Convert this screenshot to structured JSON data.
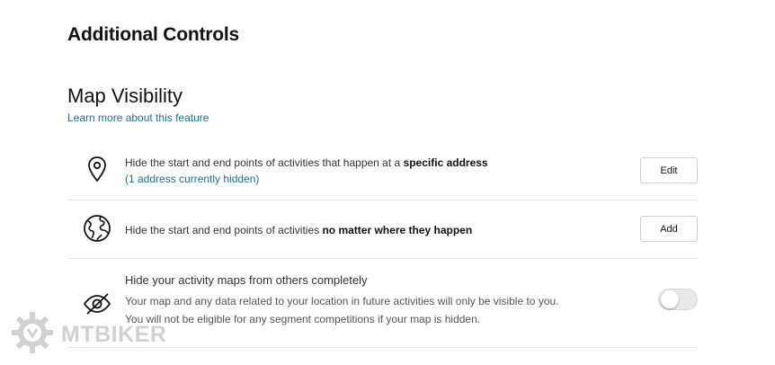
{
  "header": {
    "title": "Additional Controls"
  },
  "map_visibility": {
    "title": "Map Visibility",
    "learn_more": "Learn more about this feature",
    "rows": [
      {
        "icon": "location-pin-icon",
        "text_before": "Hide the start and end points of activities that happen at a ",
        "text_bold": "specific address",
        "hint": "(1 address currently hidden)",
        "button": "Edit"
      },
      {
        "icon": "globe-icon",
        "text_before": "Hide the start and end points of activities ",
        "text_bold": "no matter where they happen",
        "button": "Add"
      },
      {
        "icon": "eye-slash-icon",
        "title": "Hide your activity maps from others completely",
        "desc_line1": "Your map and any data related to your location in future activities will only be visible to you.",
        "desc_line2": "You will not be eligible for any segment competitions if your map is hidden.",
        "toggle_on": false
      }
    ]
  },
  "watermark": {
    "icon": "gear-logo-icon",
    "text": "MTBIKER"
  },
  "colors": {
    "link": "#1b6f9a",
    "divider": "#e6e6ea",
    "text": "#242428"
  }
}
